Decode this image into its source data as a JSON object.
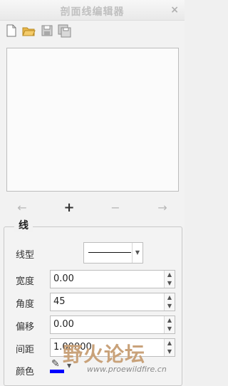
{
  "window": {
    "title": "剖面线编辑器",
    "close_glyph": "×"
  },
  "toolbar": {
    "buttons": [
      {
        "icon": "new-file-icon"
      },
      {
        "icon": "open-folder-icon"
      },
      {
        "icon": "save-icon"
      },
      {
        "icon": "save-as-icon"
      }
    ]
  },
  "nav": {
    "prev": "←",
    "add": "+",
    "remove": "−",
    "next": "→"
  },
  "group": {
    "title": "线",
    "fields": {
      "linetype_label": "线型",
      "width_label": "宽度",
      "width_value": "0.00",
      "angle_label": "角度",
      "angle_value": "45",
      "offset_label": "偏移",
      "offset_value": "0.00",
      "spacing_label": "间距",
      "spacing_value": "1.00000",
      "color_label": "颜色",
      "color_value": "#0000ff"
    }
  },
  "watermark": {
    "text": "野火论坛",
    "site": "www.proewildfire.cn"
  }
}
